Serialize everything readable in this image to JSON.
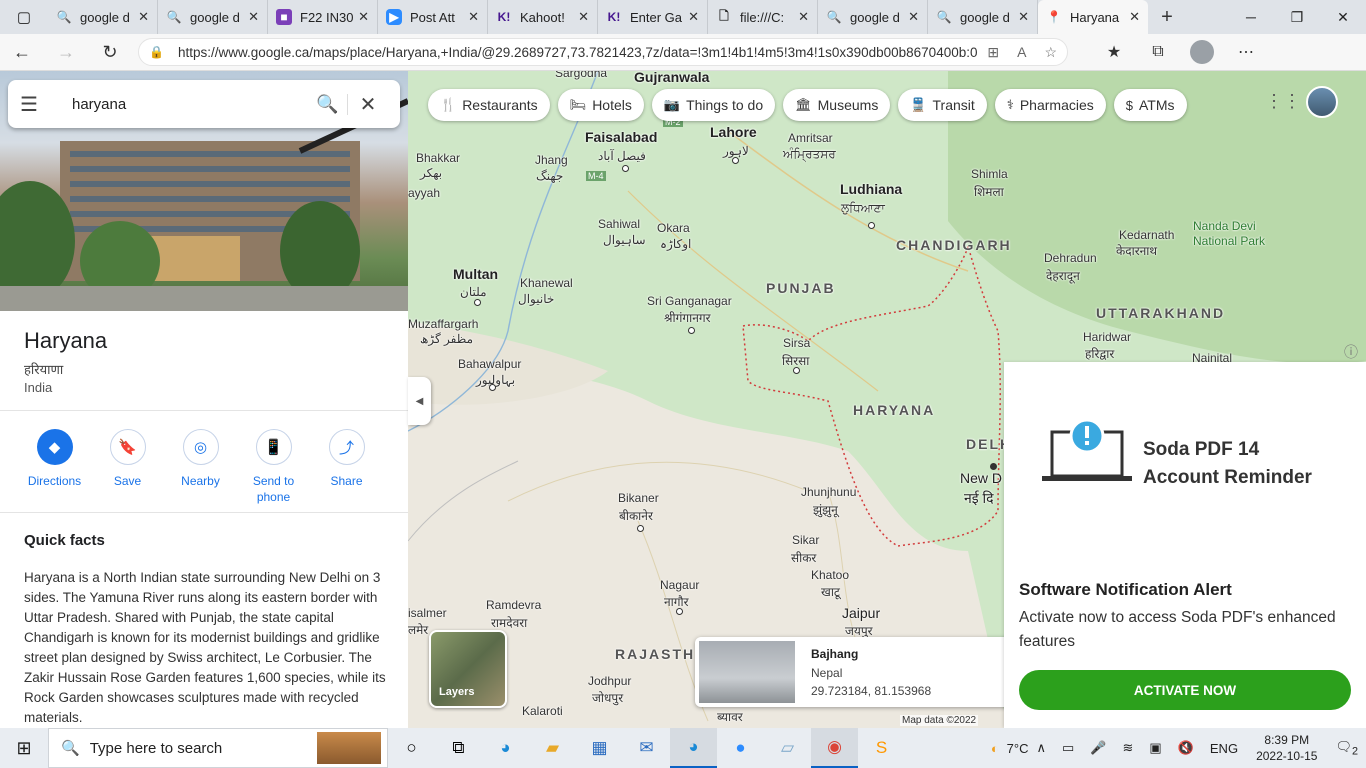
{
  "browser": {
    "tabs": [
      {
        "label": "google d",
        "icon": "search-icon",
        "active": false
      },
      {
        "label": "google d",
        "icon": "search-icon",
        "active": false
      },
      {
        "label": "F22 IN30",
        "icon": "purple-app-icon",
        "active": false
      },
      {
        "label": "Post Att",
        "icon": "zoom-icon",
        "active": false
      },
      {
        "label": "Kahoot!",
        "icon": "kahoot-icon",
        "active": false
      },
      {
        "label": "Enter Ga",
        "icon": "kahoot-icon",
        "active": false
      },
      {
        "label": "file:///C:",
        "icon": "file-icon",
        "active": false
      },
      {
        "label": "google d",
        "icon": "search-icon",
        "active": false
      },
      {
        "label": "google d",
        "icon": "search-icon",
        "active": false
      },
      {
        "label": "Haryana",
        "icon": "maps-pin-icon",
        "active": true
      }
    ],
    "url": "https://www.google.ca/maps/place/Haryana,+India/@29.2689727,73.7821423,7z/data=!3m1!4b1!4m5!3m4!1s0x390db00b8670400b:0x732..."
  },
  "search": {
    "query": "haryana"
  },
  "place": {
    "title": "Haryana",
    "native_name": "हरियाणा",
    "country": "India",
    "actions": [
      {
        "label": "Directions",
        "icon": "directions-icon"
      },
      {
        "label": "Save",
        "icon": "bookmark-icon"
      },
      {
        "label": "Nearby",
        "icon": "nearby-icon"
      },
      {
        "label": "Send to phone",
        "icon": "send-to-phone-icon"
      },
      {
        "label": "Share",
        "icon": "share-icon"
      }
    ],
    "quick_facts_heading": "Quick facts",
    "quick_facts_text": "Haryana is a North Indian state surrounding New Delhi on 3 sides. The Yamuna River runs along its eastern border with Uttar Pradesh. Shared with Punjab, the state capital Chandigarh is known for its modernist buildings and gridlike street plan designed by Swiss architect, Le Corbusier. The Zakir Hussain Rose Garden features 1,600 species, while its Rock Garden showcases sculptures made with recycled materials."
  },
  "chips": [
    {
      "label": "Restaurants",
      "icon": "fork-knife-icon"
    },
    {
      "label": "Hotels",
      "icon": "bed-icon"
    },
    {
      "label": "Things to do",
      "icon": "camera-icon"
    },
    {
      "label": "Museums",
      "icon": "museum-icon"
    },
    {
      "label": "Transit",
      "icon": "train-icon"
    },
    {
      "label": "Pharmacies",
      "icon": "pharmacy-icon"
    },
    {
      "label": "ATMs",
      "icon": "atm-icon"
    }
  ],
  "map": {
    "labels": {
      "sargodha": "Sargodha",
      "gujranwala": "Gujranwala",
      "faisalabad": "Faisalabad",
      "faisalabad_native": "فیصل آباد",
      "lahore": "Lahore",
      "lahore_native": "لاہور",
      "amritsar": "Amritsar",
      "amritsar_native": "ਅੰਮ੍ਰਿਤਸਰ",
      "bhakkar": "Bhakkar",
      "bhakkar_native": "بھکر",
      "jhang": "Jhang",
      "jhang_native": "جھنگ",
      "layyah": "ayyah",
      "ludhiana": "Ludhiana",
      "ludhiana_native": "ਲੁਧਿਆਣਾ",
      "shimla": "Shimla",
      "shimla_native": "शिमला",
      "sahiwal": "Sahiwal",
      "sahiwal_native": "ساہیوال",
      "okara": "Okara",
      "okara_native": "اوکاڑہ",
      "chandigarh": "CHANDIGARH",
      "kedarnath": "Kedarnath",
      "kedarnath_native": "केदारनाथ",
      "nanda_devi": "Nanda Devi National Park",
      "dehradun": "Dehradun",
      "dehradun_native": "देहरादून",
      "multan": "Multan",
      "multan_native": "ملتان",
      "khanewal": "Khanewal",
      "khanewal_native": "خانیوال",
      "punjab": "PUNJAB",
      "uttarakhand": "UTTARAKHAND",
      "sri_ganganagar": "Sri Ganganagar",
      "sri_ganganagar_native": "श्रीगंगानगर",
      "muzaffargarh": "Muzaffargarh",
      "muzaffargarh_native": "مظفر گڑھ",
      "haridwar": "Haridwar",
      "haridwar_native": "हरिद्वार",
      "sirsa": "Sirsa",
      "sirsa_native": "सिरसा",
      "nainital": "Nainital",
      "bahawalpur": "Bahawalpur",
      "bahawalpur_native": "بہاولپور",
      "haryana": "HARYANA",
      "delhi": "DELHI",
      "new_delhi": "New D",
      "new_delhi_native": "नई दि",
      "bikaner": "Bikaner",
      "bikaner_native": "बीकानेर",
      "jhunjhunu": "Jhunjhunu",
      "jhunjhunu_native": "झुंझुनू",
      "sikar": "Sikar",
      "sikar_native": "सीकर",
      "khatoo": "Khatoo",
      "khatoo_native": "खाटू",
      "nagaur": "Nagaur",
      "nagaur_native": "नागौर",
      "ramdevra": "Ramdevra",
      "ramdevra_native": "रामदेवरा",
      "jaisalmer": "isalmer",
      "jaisalmer_native": "लमेर",
      "jaipur": "Jaipur",
      "jaipur_native": "जयपुर",
      "rajasthan": "RAJASTH",
      "jodhpur": "Jodhpur",
      "jodhpur_native": "जोधपुर",
      "kalaroti": "Kalaroti",
      "beawar": "ब्यावर",
      "m2": "M-2",
      "m4": "M-4"
    },
    "layers_label": "Layers",
    "place_card": {
      "name": "Bajhang",
      "country": "Nepal",
      "coords": "29.723184, 81.153968"
    },
    "attribution": "Map data ©2022"
  },
  "popup": {
    "brand_line1": "Soda PDF 14",
    "brand_line2": "Account Reminder",
    "heading": "Software Notification Alert",
    "body": "Activate now to access Soda PDF's enhanced features",
    "button": "ACTIVATE NOW"
  },
  "taskbar": {
    "search_placeholder": "Type here to search",
    "temperature": "7°C",
    "language": "ENG",
    "time": "8:39 PM",
    "date": "2022-10-15",
    "notification_count": "2"
  }
}
